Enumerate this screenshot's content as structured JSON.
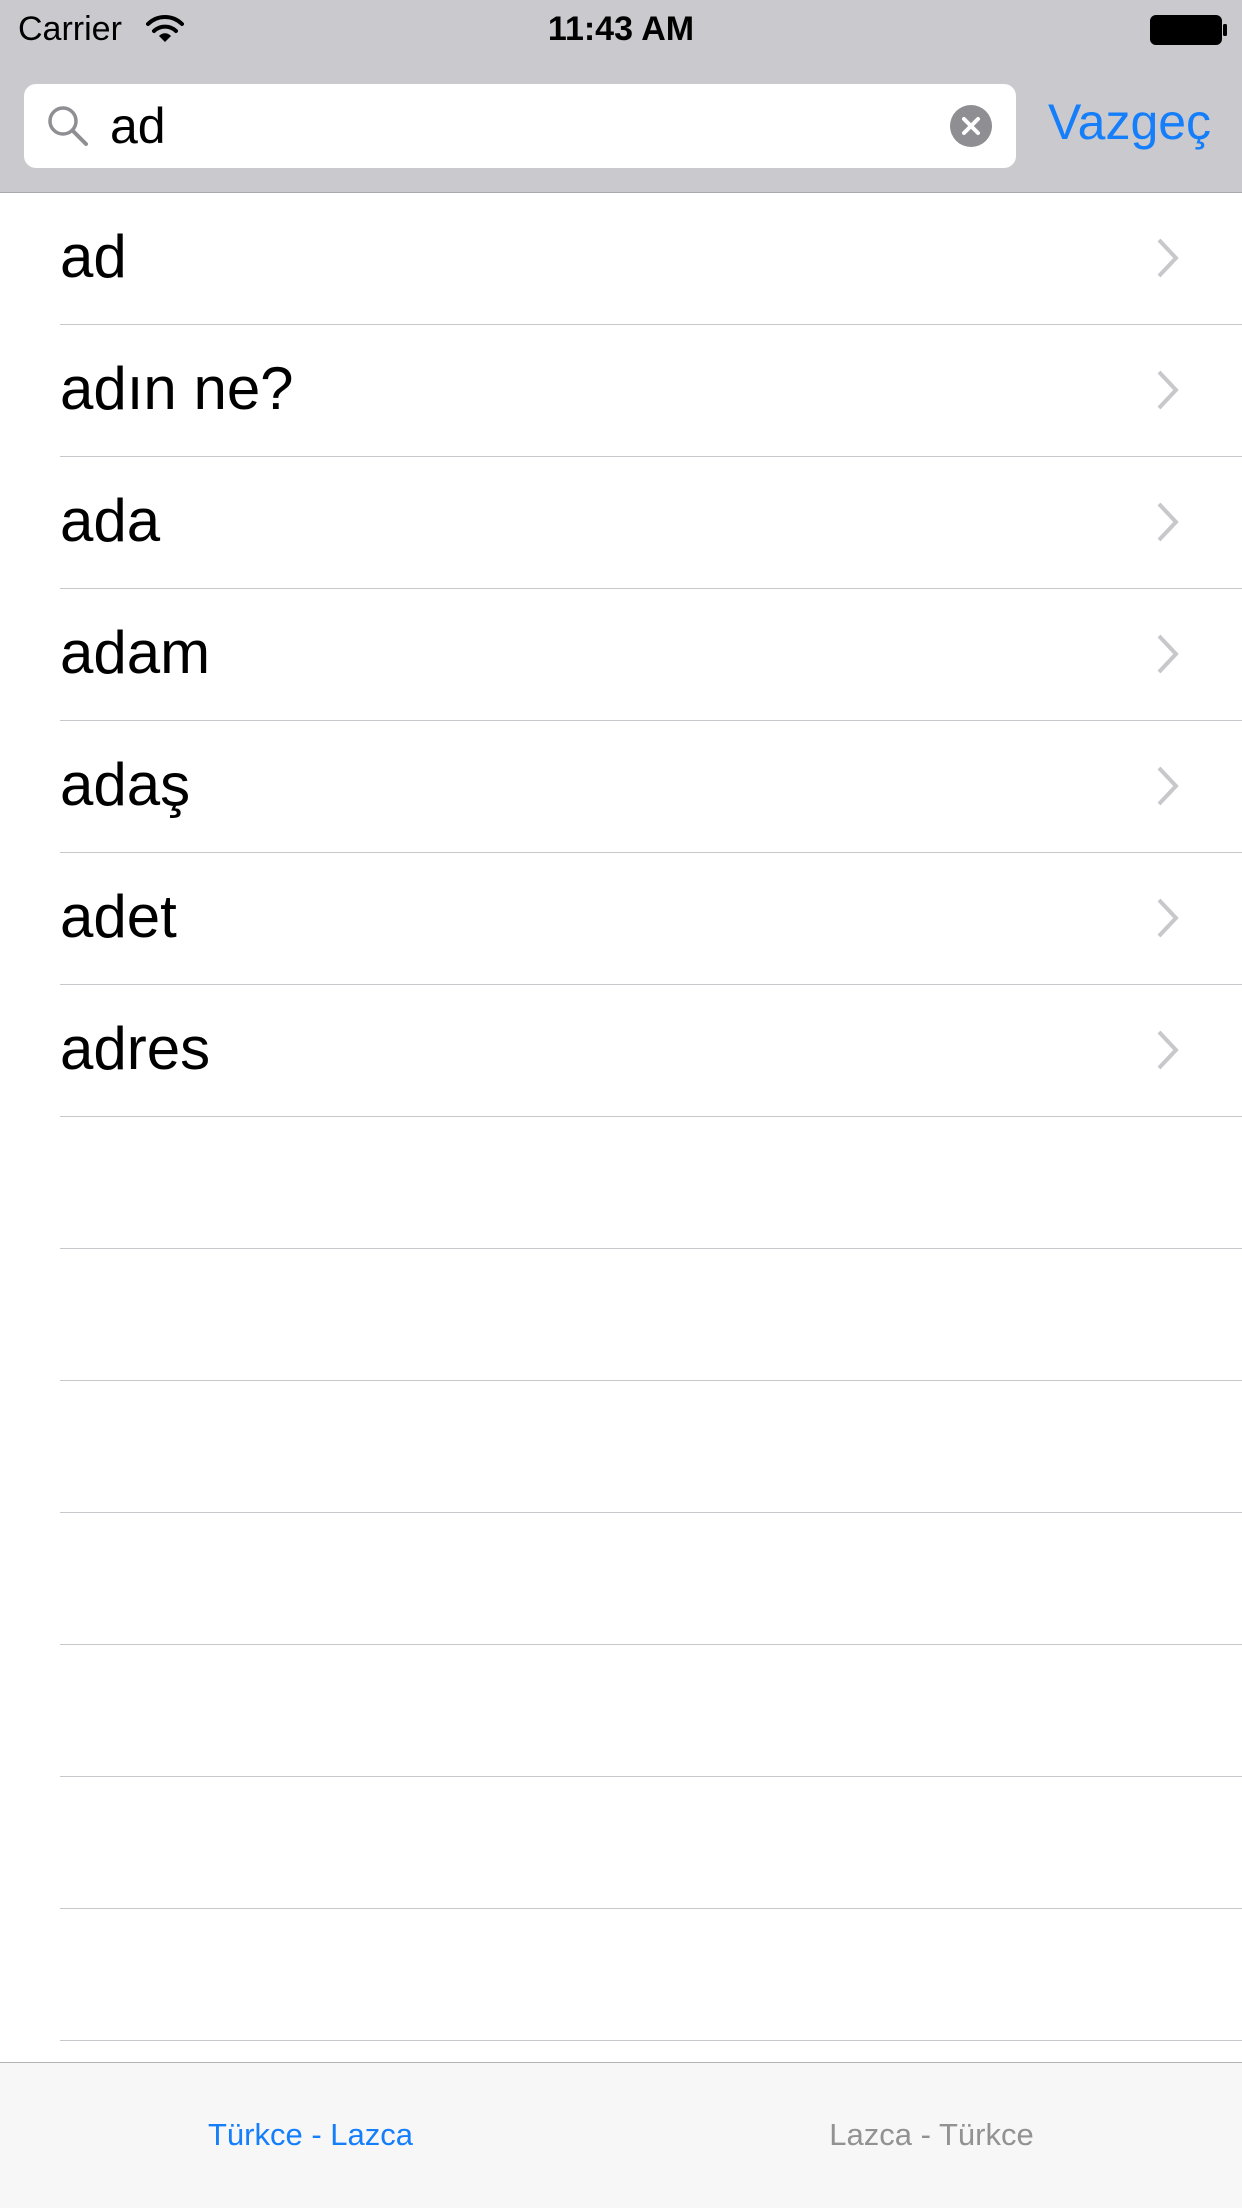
{
  "status_bar": {
    "carrier": "Carrier",
    "time": "11:43 AM"
  },
  "search": {
    "query": "ad",
    "cancel_label": "Vazgeç"
  },
  "results": [
    {
      "label": "ad"
    },
    {
      "label": "adın ne?"
    },
    {
      "label": "ada"
    },
    {
      "label": "adam"
    },
    {
      "label": "adaş"
    },
    {
      "label": "adet"
    },
    {
      "label": "adres"
    }
  ],
  "empty_rows": 7,
  "tabs": [
    {
      "label": "Türkce - Lazca",
      "selected": true
    },
    {
      "label": "Lazca - Türkce",
      "selected": false
    }
  ],
  "colors": {
    "accent": "#147efb",
    "tab_inactive": "#929292",
    "chevron": "#c7c7cc",
    "search_bar_bg": "#c9c9ce"
  },
  "icons": {
    "wifi": "wifi-icon",
    "battery": "battery-icon",
    "search": "search-icon",
    "clear": "clear-icon",
    "disclosure": "chevron-right-icon"
  }
}
